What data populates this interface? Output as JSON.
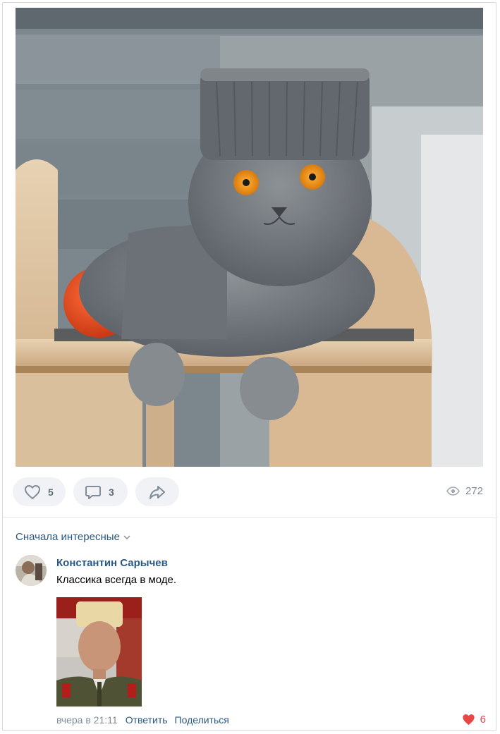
{
  "post": {
    "photo": "cat-with-flat-top-haircut-photo",
    "likes": "5",
    "comments": "3",
    "views": "272"
  },
  "comments_section": {
    "sort_label": "Сначала интересные",
    "items": [
      {
        "author": "Константин Сарычев",
        "text": "Классика всегда в моде.",
        "attachment": "man-with-flat-top-haircut-in-uniform-photo",
        "time": "вчера в 21:11",
        "reply_label": "Ответить",
        "share_label": "Поделиться",
        "likes": "6"
      }
    ]
  },
  "colors": {
    "link": "#2a5885",
    "muted": "#818c99",
    "pill_bg": "#f0f2f5",
    "like_red": "#e64646"
  }
}
